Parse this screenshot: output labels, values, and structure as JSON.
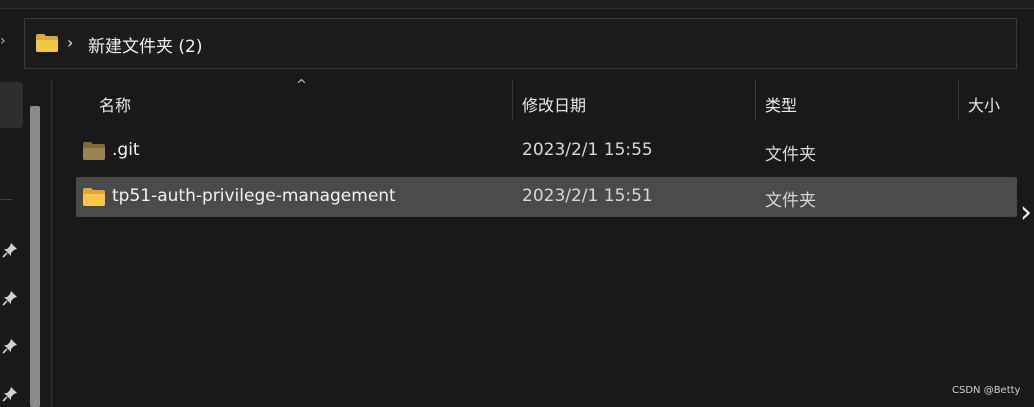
{
  "address": {
    "folder_icon": "folder-icon",
    "chevron": "›",
    "path": "新建文件夹 (2)"
  },
  "columns": {
    "name": "名称",
    "modified": "修改日期",
    "type": "类型",
    "size": "大小",
    "sort_indicator": "^"
  },
  "files": [
    {
      "name": ".git",
      "modified": "2023/2/1 15:55",
      "type": "文件夹",
      "icon": "folder-icon",
      "selected": false
    },
    {
      "name": "tp51-auth-privilege-management",
      "modified": "2023/2/1 15:51",
      "type": "文件夹",
      "icon": "folder-icon",
      "selected": true
    }
  ],
  "colors": {
    "folder": "#f4c542",
    "folder_dim": "#9c8452",
    "selection": "#4a4a4a",
    "background": "#191919"
  },
  "watermark": "CSDN @Betty"
}
